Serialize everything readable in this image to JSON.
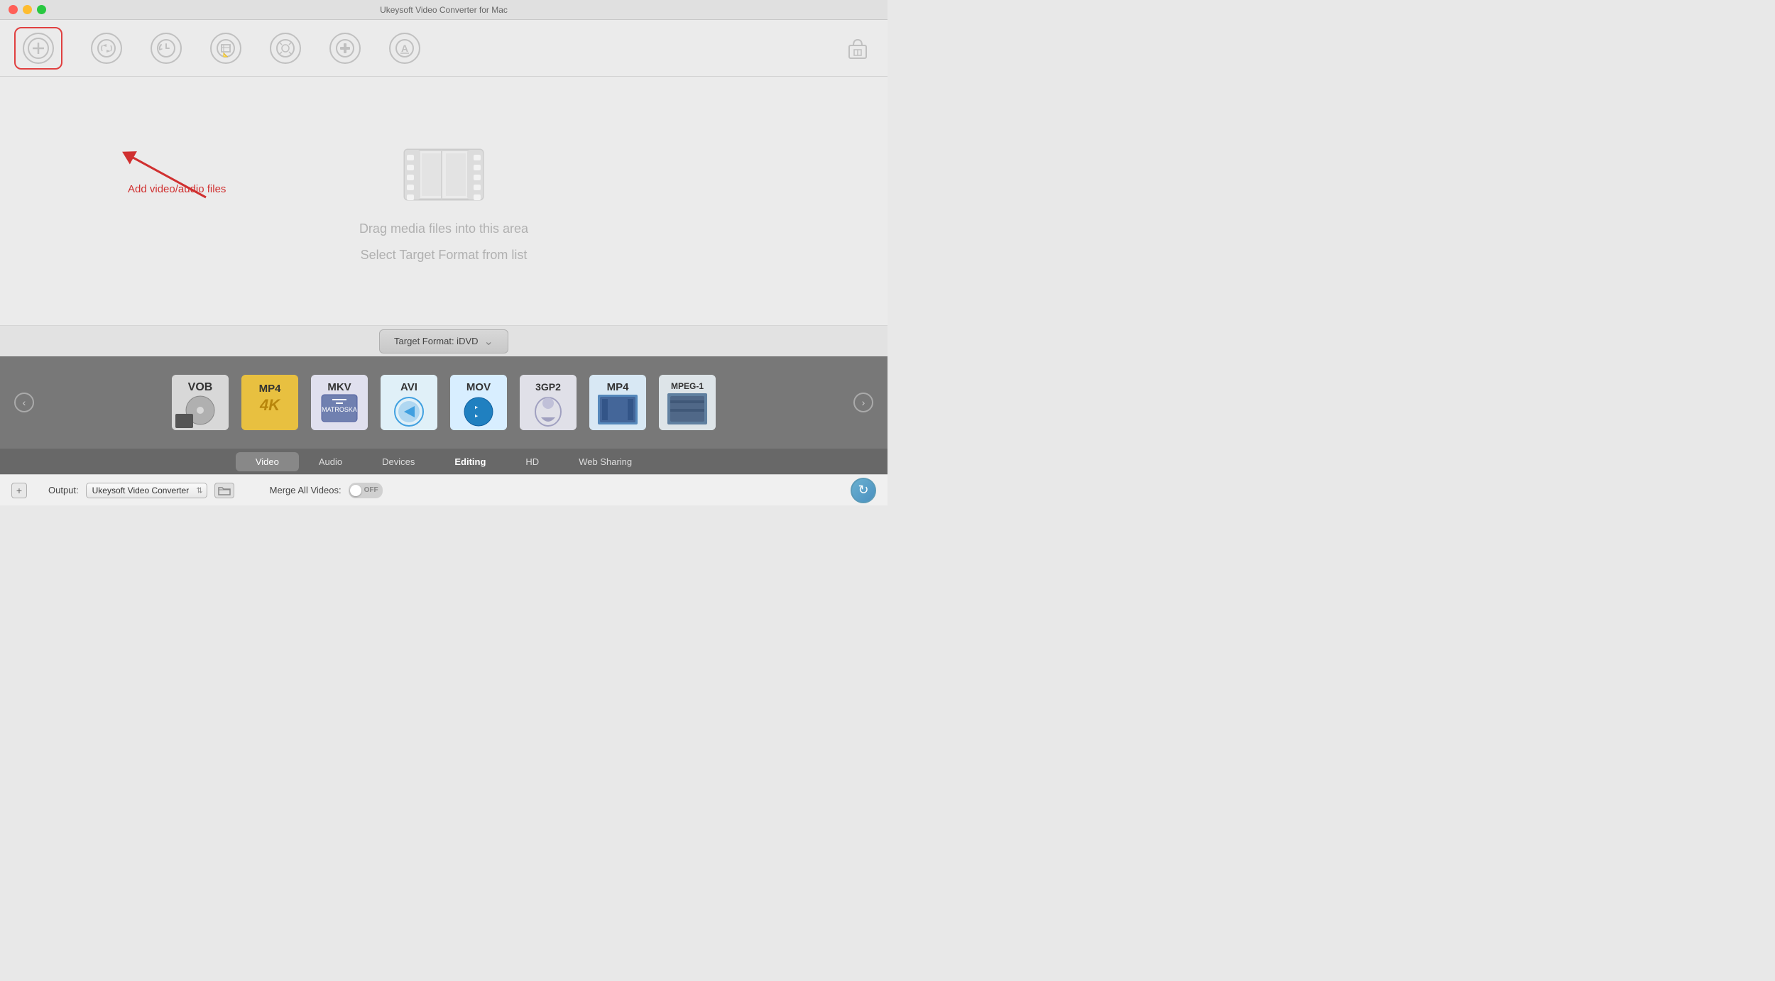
{
  "window": {
    "title": "Ukeysoft Video Converter for Mac"
  },
  "toolbar": {
    "buttons": [
      {
        "id": "add",
        "icon": "+",
        "label": ""
      },
      {
        "id": "convert",
        "icon": "✂",
        "label": ""
      },
      {
        "id": "history",
        "icon": "↺",
        "label": ""
      },
      {
        "id": "resize",
        "icon": "⊡",
        "label": ""
      },
      {
        "id": "effects",
        "icon": "✦",
        "label": ""
      },
      {
        "id": "tools",
        "icon": "⊥",
        "label": ""
      },
      {
        "id": "text",
        "icon": "A",
        "label": ""
      }
    ],
    "store_label": "🛍"
  },
  "annotation": {
    "text": "Add video/audio files"
  },
  "main": {
    "drag_text": "Drag media files into this area",
    "select_text": "Select Target Format from list"
  },
  "target_format": {
    "label": "Target Format: iDVD",
    "chevron": "⌄"
  },
  "format_panel": {
    "items": [
      {
        "label": "VOB",
        "color": "#c8c8c8"
      },
      {
        "label": "MP4",
        "color": "#f0c040"
      },
      {
        "label": "MKV",
        "color": "#88aacc"
      },
      {
        "label": "AVI",
        "color": "#60b0e0"
      },
      {
        "label": "MOV",
        "color": "#3090e0"
      },
      {
        "label": "3GP2",
        "color": "#c0c0d0"
      },
      {
        "label": "MP4",
        "color": "#5090c0"
      },
      {
        "label": "MPEG-1",
        "color": "#8090a0"
      }
    ],
    "prev_label": "‹",
    "next_label": "›"
  },
  "category_tabs": [
    {
      "id": "video",
      "label": "Video",
      "active": true
    },
    {
      "id": "audio",
      "label": "Audio"
    },
    {
      "id": "devices",
      "label": "Devices"
    },
    {
      "id": "editing",
      "label": "Editing",
      "bold": true
    },
    {
      "id": "hd",
      "label": "HD"
    },
    {
      "id": "web-sharing",
      "label": "Web Sharing"
    }
  ],
  "bottom_bar": {
    "output_label": "Output:",
    "output_value": "Ukeysoft Video Converter",
    "merge_label": "Merge All Videos:",
    "toggle_state": "OFF",
    "refresh_icon": "↻"
  }
}
